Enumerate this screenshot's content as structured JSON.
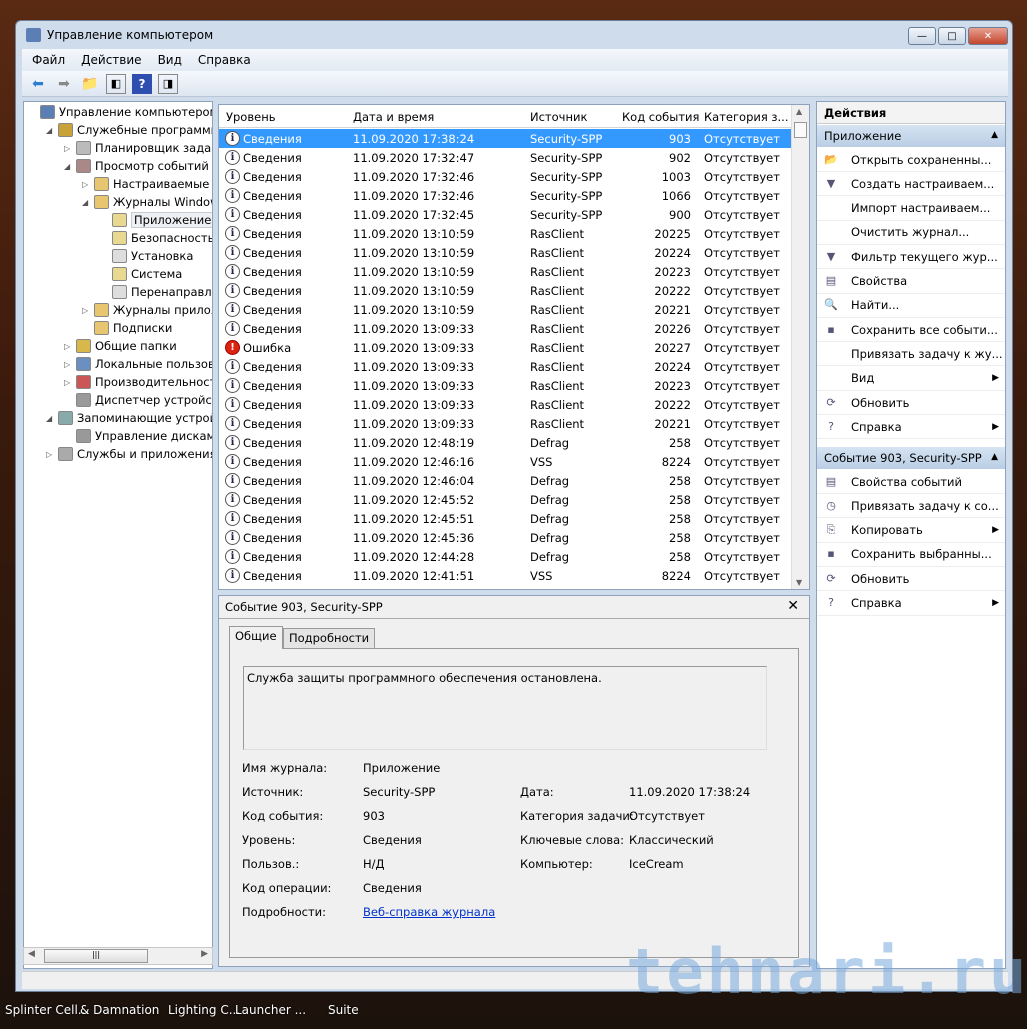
{
  "window": {
    "title": "Управление компьютером",
    "min": "—",
    "max": "□",
    "close": "✕"
  },
  "menu": [
    "Файл",
    "Действие",
    "Вид",
    "Справка"
  ],
  "tree": [
    {
      "label": "Управление компьютером (л",
      "level": 0,
      "exp": "",
      "color": "#5b7fb5"
    },
    {
      "label": "Служебные программы",
      "level": 1,
      "exp": "◢",
      "color": "#c9a23a"
    },
    {
      "label": "Планировщик заданий",
      "level": 2,
      "exp": "▷",
      "color": "#bbb"
    },
    {
      "label": "Просмотр событий",
      "level": 2,
      "exp": "◢",
      "color": "#a88"
    },
    {
      "label": "Настраиваемые пр",
      "level": 3,
      "exp": "▷",
      "color": "#e8c670"
    },
    {
      "label": "Журналы Windows",
      "level": 3,
      "exp": "◢",
      "color": "#e8c670"
    },
    {
      "label": "Приложение",
      "level": 4,
      "exp": "",
      "color": "#e8d890",
      "selected": true
    },
    {
      "label": "Безопасность",
      "level": 4,
      "exp": "",
      "color": "#e8d890"
    },
    {
      "label": "Установка",
      "level": 4,
      "exp": "",
      "color": "#ddd"
    },
    {
      "label": "Система",
      "level": 4,
      "exp": "",
      "color": "#e8d890"
    },
    {
      "label": "Перенаправлен",
      "level": 4,
      "exp": "",
      "color": "#ddd"
    },
    {
      "label": "Журналы приложе",
      "level": 3,
      "exp": "▷",
      "color": "#e8c670"
    },
    {
      "label": "Подписки",
      "level": 3,
      "exp": "",
      "color": "#e8c670"
    },
    {
      "label": "Общие папки",
      "level": 2,
      "exp": "▷",
      "color": "#d8b84a"
    },
    {
      "label": "Локальные пользовате",
      "level": 2,
      "exp": "▷",
      "color": "#6a8fc0"
    },
    {
      "label": "Производительность",
      "level": 2,
      "exp": "▷",
      "color": "#c55"
    },
    {
      "label": "Диспетчер устройств",
      "level": 2,
      "exp": "",
      "color": "#999"
    },
    {
      "label": "Запоминающие устройст",
      "level": 1,
      "exp": "◢",
      "color": "#8aa"
    },
    {
      "label": "Управление дисками",
      "level": 2,
      "exp": "",
      "color": "#999"
    },
    {
      "label": "Службы и приложения",
      "level": 1,
      "exp": "▷",
      "color": "#aaa"
    }
  ],
  "list": {
    "headers": [
      "Уровень",
      "Дата и время",
      "Источник",
      "Код события",
      "Категория з..."
    ],
    "rows": [
      [
        "Сведения",
        "11.09.2020 17:38:24",
        "Security-SPP",
        "903",
        "Отсутствует"
      ],
      [
        "Сведения",
        "11.09.2020 17:32:47",
        "Security-SPP",
        "902",
        "Отсутствует"
      ],
      [
        "Сведения",
        "11.09.2020 17:32:46",
        "Security-SPP",
        "1003",
        "Отсутствует"
      ],
      [
        "Сведения",
        "11.09.2020 17:32:46",
        "Security-SPP",
        "1066",
        "Отсутствует"
      ],
      [
        "Сведения",
        "11.09.2020 17:32:45",
        "Security-SPP",
        "900",
        "Отсутствует"
      ],
      [
        "Сведения",
        "11.09.2020 13:10:59",
        "RasClient",
        "20225",
        "Отсутствует"
      ],
      [
        "Сведения",
        "11.09.2020 13:10:59",
        "RasClient",
        "20224",
        "Отсутствует"
      ],
      [
        "Сведения",
        "11.09.2020 13:10:59",
        "RasClient",
        "20223",
        "Отсутствует"
      ],
      [
        "Сведения",
        "11.09.2020 13:10:59",
        "RasClient",
        "20222",
        "Отсутствует"
      ],
      [
        "Сведения",
        "11.09.2020 13:10:59",
        "RasClient",
        "20221",
        "Отсутствует"
      ],
      [
        "Сведения",
        "11.09.2020 13:09:33",
        "RasClient",
        "20226",
        "Отсутствует"
      ],
      [
        "Ошибка",
        "11.09.2020 13:09:33",
        "RasClient",
        "20227",
        "Отсутствует"
      ],
      [
        "Сведения",
        "11.09.2020 13:09:33",
        "RasClient",
        "20224",
        "Отсутствует"
      ],
      [
        "Сведения",
        "11.09.2020 13:09:33",
        "RasClient",
        "20223",
        "Отсутствует"
      ],
      [
        "Сведения",
        "11.09.2020 13:09:33",
        "RasClient",
        "20222",
        "Отсутствует"
      ],
      [
        "Сведения",
        "11.09.2020 13:09:33",
        "RasClient",
        "20221",
        "Отсутствует"
      ],
      [
        "Сведения",
        "11.09.2020 12:48:19",
        "Defrag",
        "258",
        "Отсутствует"
      ],
      [
        "Сведения",
        "11.09.2020 12:46:16",
        "VSS",
        "8224",
        "Отсутствует"
      ],
      [
        "Сведения",
        "11.09.2020 12:46:04",
        "Defrag",
        "258",
        "Отсутствует"
      ],
      [
        "Сведения",
        "11.09.2020 12:45:52",
        "Defrag",
        "258",
        "Отсутствует"
      ],
      [
        "Сведения",
        "11.09.2020 12:45:51",
        "Defrag",
        "258",
        "Отсутствует"
      ],
      [
        "Сведения",
        "11.09.2020 12:45:36",
        "Defrag",
        "258",
        "Отсутствует"
      ],
      [
        "Сведения",
        "11.09.2020 12:44:28",
        "Defrag",
        "258",
        "Отсутствует"
      ],
      [
        "Сведения",
        "11.09.2020 12:41:51",
        "VSS",
        "8224",
        "Отсутствует"
      ]
    ]
  },
  "detail": {
    "title": "Событие 903, Security-SPP",
    "close": "✕",
    "tabs": [
      "Общие",
      "Подробности"
    ],
    "description": "Служба защиты программного обеспечения остановлена.",
    "fields_left": [
      [
        "Имя журнала:",
        "Приложение"
      ],
      [
        "Источник:",
        "Security-SPP"
      ],
      [
        "Код события:",
        "903"
      ],
      [
        "Уровень:",
        "Сведения"
      ],
      [
        "Пользов.:",
        "Н/Д"
      ],
      [
        "Код операции:",
        "Сведения"
      ],
      [
        "Подробности:",
        "Веб-справка журнала"
      ]
    ],
    "fields_right": [
      [
        "Дата:",
        "11.09.2020 17:38:24"
      ],
      [
        "Категория задачи:",
        "Отсутствует"
      ],
      [
        "Ключевые слова:",
        "Классический"
      ],
      [
        "Компьютер:",
        "IceCream"
      ]
    ]
  },
  "actions": {
    "title": "Действия",
    "section1": "Приложение",
    "items1": [
      [
        "Открыть сохраненны...",
        "📂",
        ""
      ],
      [
        "Создать настраиваем...",
        "▼",
        ""
      ],
      [
        "Импорт настраиваем...",
        "",
        ""
      ],
      [
        "Очистить журнал...",
        "",
        ""
      ],
      [
        "Фильтр текущего жур...",
        "▼",
        ""
      ],
      [
        "Свойства",
        "▤",
        ""
      ],
      [
        "Найти...",
        "🔍",
        ""
      ],
      [
        "Сохранить все событи...",
        "▪",
        ""
      ],
      [
        "Привязать задачу к жу...",
        "",
        ""
      ],
      [
        "Вид",
        "",
        "▶"
      ],
      [
        "Обновить",
        "⟳",
        ""
      ],
      [
        "Справка",
        "?",
        "▶"
      ]
    ],
    "section2": "Событие 903, Security-SPP",
    "items2": [
      [
        "Свойства событий",
        "▤",
        ""
      ],
      [
        "Привязать задачу к со...",
        "◷",
        ""
      ],
      [
        "Копировать",
        "⎘",
        "▶"
      ],
      [
        "Сохранить выбранны...",
        "▪",
        ""
      ],
      [
        "Обновить",
        "⟳",
        ""
      ],
      [
        "Справка",
        "?",
        "▶"
      ]
    ],
    "collapse": "▲"
  },
  "taskbar": [
    "Splinter Cell...",
    "& Damnation",
    "Lighting C...",
    "Launcher ...",
    "Suite"
  ],
  "watermark": "tehnari.ru"
}
